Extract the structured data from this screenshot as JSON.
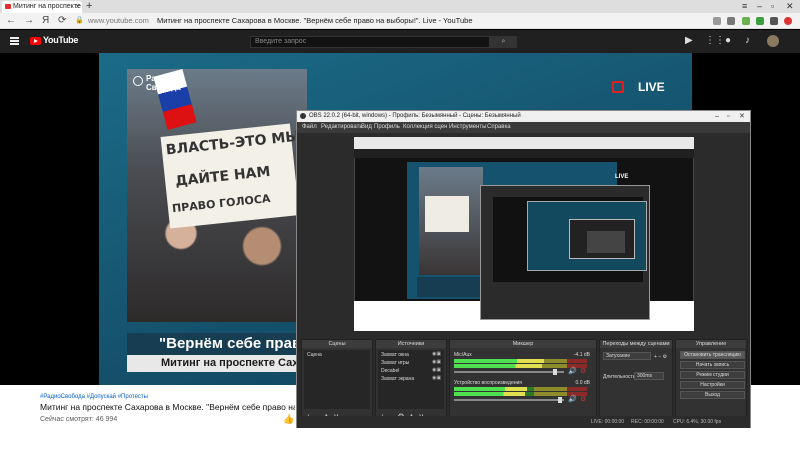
{
  "browser": {
    "tab_title": "Митинг на проспекте",
    "new_tab": "+",
    "url_host": "www.youtube.com",
    "page_title": "Митинг на проспекте Сахарова в Москве. \"Вернём себе право на выборы!\". Live - YouTube",
    "nav": {
      "back": "←",
      "forward": "→",
      "yandex": "Я",
      "reload": "⟳",
      "lock": "🔒"
    },
    "window": {
      "menu": "≡",
      "minimize": "–",
      "maximize": "▫",
      "close": "✕"
    }
  },
  "youtube": {
    "logo_text": "YouTube",
    "search_placeholder": "Введите запрос",
    "search_button": "⌕",
    "icons": [
      "camera-icon",
      "apps-icon",
      "messages-icon",
      "bell-icon"
    ]
  },
  "video": {
    "brand_line1": "Радио",
    "brand_line2": "Свобода",
    "live": "LIVE",
    "banner_line1": "ВЛАСТЬ-ЭТО МЫ",
    "banner_line2": "ДАЙТЕ НАМ",
    "banner_line3": "ПРАВО ГОЛОСА",
    "caption1": "\"Вернём себе право",
    "caption2": "Митинг на проспекте Саха"
  },
  "below": {
    "tags": "#РадиоСвобода #Допускай #Протесты",
    "title": "Митинг на проспекте Сахарова в Москве. \"Вернём себе право на выборы",
    "views": "Сейчас смотрят: 46 994",
    "like_icon": "👍"
  },
  "obs": {
    "title": "OBS 22.0.2 (64-bit, windows) - Профиль: Безымянный - Сцены: Безымянный",
    "menu": [
      "Файл",
      "Редактировать",
      "Вид",
      "Профиль",
      "Коллекция сцен",
      "Инструменты",
      "Справка"
    ],
    "preview_live": "LIVE",
    "docks": {
      "scenes": {
        "title": "Сцены",
        "items": [
          "Сцена"
        ]
      },
      "sources": {
        "title": "Источники",
        "items": [
          "Захват окна",
          "Захват игры",
          "Decabel",
          "Захват экрана"
        ]
      },
      "mixer": {
        "title": "Микшер",
        "channels": [
          {
            "name": "Mic/Aux",
            "db": "-4.1 dB",
            "level": 0.68,
            "volume": 0.92
          },
          {
            "name": "Устройство воспроизведения",
            "db": "0.0 dB",
            "level": 0.55,
            "volume": 0.96
          }
        ]
      },
      "transitions": {
        "title": "Переходы между сценами",
        "type": "Затухание",
        "duration_label": "Длительность",
        "duration_value": "300ms"
      },
      "controls": {
        "title": "Управление",
        "buttons": [
          "Остановить трансляцию",
          "Начать запись",
          "Режим студии",
          "Настройки",
          "Выход"
        ]
      }
    },
    "status": {
      "live": "LIVE: 00:00:00",
      "rec": "REC: 00:00:00",
      "cpu": "CPU: 6.4%, 30.00 fps"
    }
  }
}
